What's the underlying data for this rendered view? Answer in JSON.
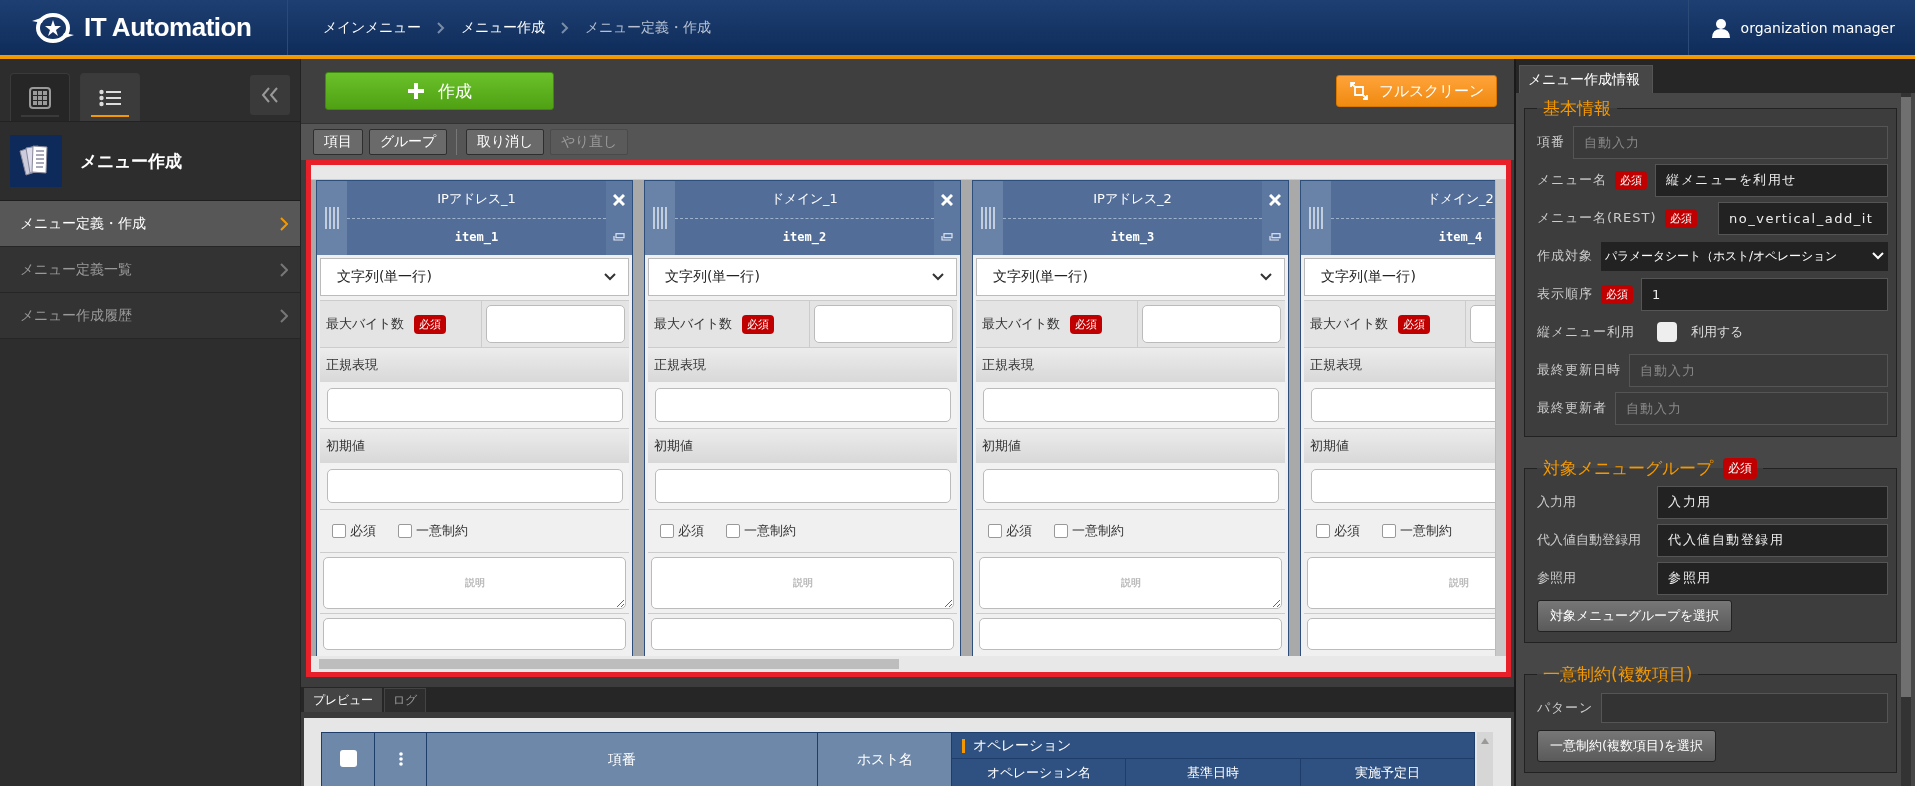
{
  "header": {
    "logo": "IT Automation",
    "breadcrumb": [
      {
        "label": "メインメニュー",
        "current": false
      },
      {
        "label": "メニュー作成",
        "current": false
      },
      {
        "label": "メニュー定義・作成",
        "current": true
      }
    ],
    "user": "organization manager"
  },
  "sidebar": {
    "tabs": [
      {
        "kind": "grid",
        "selected": false
      },
      {
        "kind": "list",
        "selected": true
      }
    ],
    "title": "メニュー作成",
    "items": [
      {
        "label": "メニュー定義・作成",
        "selected": true
      },
      {
        "label": "メニュー定義一覧",
        "selected": false
      },
      {
        "label": "メニュー作成履歴",
        "selected": false
      }
    ]
  },
  "toolbar": {
    "create": "作成",
    "fullscreen": "フルスクリーン",
    "buttons": [
      {
        "label": "項目",
        "disabled": false
      },
      {
        "label": "グループ",
        "disabled": false
      },
      {
        "label": "取り消し",
        "disabled": false
      },
      {
        "label": "やり直し",
        "disabled": true
      }
    ]
  },
  "columns": [
    {
      "name": "IPアドレス_1",
      "rest": "item_1",
      "type": "文字列(単一行)",
      "max_bytes_label": "最大バイト数",
      "badge": "必須",
      "regex_label": "正規表現",
      "default_label": "初期値",
      "required": {
        "label": "必須",
        "checked": false
      },
      "unique": {
        "label": "一意制約",
        "checked": false
      },
      "description_placeholder": "説明"
    },
    {
      "name": "ドメイン_1",
      "rest": "item_2",
      "type": "文字列(単一行)",
      "max_bytes_label": "最大バイト数",
      "badge": "必須",
      "regex_label": "正規表現",
      "default_label": "初期値",
      "required": {
        "label": "必須",
        "checked": false
      },
      "unique": {
        "label": "一意制約",
        "checked": false
      },
      "description_placeholder": "説明"
    },
    {
      "name": "IPアドレス_2",
      "rest": "item_3",
      "type": "文字列(単一行)",
      "max_bytes_label": "最大バイト数",
      "badge": "必須",
      "regex_label": "正規表現",
      "default_label": "初期値",
      "required": {
        "label": "必須",
        "checked": false
      },
      "unique": {
        "label": "一意制約",
        "checked": false
      },
      "description_placeholder": "説明"
    },
    {
      "name": "ドメイン_2",
      "rest": "item_4",
      "type": "文字列(単一行)",
      "max_bytes_label": "最大バイト数",
      "badge": "必須",
      "regex_label": "正規表現",
      "default_label": "初期値",
      "required": {
        "label": "必須",
        "checked": false
      },
      "unique": {
        "label": "一意制約",
        "checked": false
      },
      "description_placeholder": "説明"
    }
  ],
  "preview": {
    "tabs": [
      {
        "label": "プレビュー",
        "selected": true
      },
      {
        "label": "ログ",
        "selected": false
      }
    ],
    "select_all_checked": false,
    "columns": [
      "項番",
      "ホスト名"
    ],
    "group": {
      "label": "オペレーション",
      "columns": [
        "オペレーション名",
        "基準日時",
        "実施予定日"
      ]
    }
  },
  "info_panel": {
    "tab": "メニュー作成情報",
    "basic": {
      "legend": "基本情報",
      "fields": [
        {
          "kind": "input",
          "label": "項番",
          "placeholder": "自動入力"
        },
        {
          "kind": "input",
          "label": "メニュー名",
          "badge": "必須",
          "value": "縦メニューを利用せ"
        },
        {
          "kind": "input",
          "label": "メニュー名(REST)",
          "badge": "必須",
          "value": "no_vertical_add_it"
        },
        {
          "kind": "select",
          "label": "作成対象",
          "value": "パラメータシート（ホスト/オペレーション"
        },
        {
          "kind": "input",
          "label": "表示順序",
          "badge": "必須",
          "value": "1"
        },
        {
          "kind": "checkbox",
          "label": "縦メニュー利用",
          "option": "利用する",
          "checked": false
        },
        {
          "kind": "input",
          "label": "最終更新日時",
          "placeholder": "自動入力"
        },
        {
          "kind": "input",
          "label": "最終更新者",
          "placeholder": "自動入力"
        }
      ]
    },
    "groups": {
      "legend": "対象メニューグループ",
      "badge": "必須",
      "fields": [
        {
          "label": "入力用",
          "value": "入力用"
        },
        {
          "label": "代入値自動登録用",
          "value": "代入値自動登録用"
        },
        {
          "label": "参照用",
          "value": "参照用"
        }
      ],
      "button": "対象メニューグループを選択"
    },
    "unique": {
      "legend": "一意制約(複数項目)",
      "fields": [
        {
          "label": "パターン"
        }
      ],
      "button": "一意制約(複数項目)を選択"
    }
  }
}
